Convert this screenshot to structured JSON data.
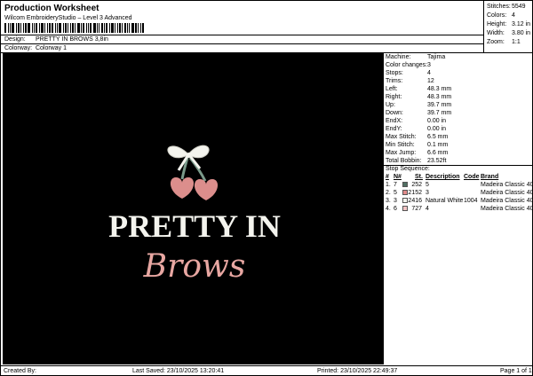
{
  "header": {
    "title": "Production Worksheet",
    "software": "Wilcom EmbroideryStudio – Level 3 Advanced",
    "design_label": "Design:",
    "design_value": "PRETTY IN BROWS 3,8in",
    "colorway_label": "Colorway:",
    "colorway_value": "Colorway 1"
  },
  "stats": [
    {
      "k": "Stitches:",
      "v": "5549"
    },
    {
      "k": "Colors:",
      "v": "4"
    },
    {
      "k": "Height:",
      "v": "3.12 in"
    },
    {
      "k": "Width:",
      "v": "3.80 in"
    },
    {
      "k": "Zoom:",
      "v": "1:1"
    }
  ],
  "details": [
    {
      "k": "Machine:",
      "v": "Tajima"
    },
    {
      "k": "Color changes:",
      "v": "3"
    },
    {
      "k": "Stops:",
      "v": "4"
    },
    {
      "k": "Trims:",
      "v": "12"
    },
    {
      "k": "Left:",
      "v": "48.3 mm"
    },
    {
      "k": "Right:",
      "v": "48.3 mm"
    },
    {
      "k": "Up:",
      "v": "39.7 mm"
    },
    {
      "k": "Down:",
      "v": "39.7 mm"
    },
    {
      "k": "EndX:",
      "v": "0.00 in"
    },
    {
      "k": "EndY:",
      "v": "0.00 in"
    },
    {
      "k": "Max Stitch:",
      "v": "6.5 mm"
    },
    {
      "k": "Min Stitch:",
      "v": "0.1 mm"
    },
    {
      "k": "Max Jump:",
      "v": "6.6 mm"
    },
    {
      "k": "Total Bobbin:",
      "v": "23.52ft"
    }
  ],
  "stop_sequence": {
    "title": "Stop Sequence:",
    "headers": {
      "num": "#",
      "n": "N#",
      "st": "St.",
      "desc": "Description",
      "code": "Code",
      "brand": "Brand"
    },
    "rows": [
      {
        "num": "1.",
        "n": "7",
        "swatch": "#4f6f62",
        "st": "252",
        "desc": "5",
        "code": "",
        "brand": "Madeira Classic 40"
      },
      {
        "num": "2.",
        "n": "5",
        "swatch": "#e08a8a",
        "st": "2152",
        "desc": "3",
        "code": "",
        "brand": "Madeira Classic 40"
      },
      {
        "num": "3.",
        "n": "3",
        "swatch": "#f4f4ee",
        "st": "2416",
        "desc": "Natural White",
        "code": "1004",
        "brand": "Madeira Classic 40"
      },
      {
        "num": "4.",
        "n": "6",
        "swatch": "#f2c4c4",
        "st": "727",
        "desc": "4",
        "code": "",
        "brand": "Madeira Classic 40"
      }
    ]
  },
  "artwork": {
    "line1": "PRETTY IN",
    "line2": "Brows",
    "colors": {
      "background": "#000000",
      "white": "#f4f4ee",
      "pink": "#e8a7a2",
      "cherry": "#dc8e8c",
      "stem": "#7a9a8a"
    }
  },
  "footer": {
    "created": "Created By:",
    "saved": "Last Saved: 23/10/2025 13:20:41",
    "printed": "Printed: 23/10/2025 22:49:37",
    "page": "Page 1 of 1"
  }
}
